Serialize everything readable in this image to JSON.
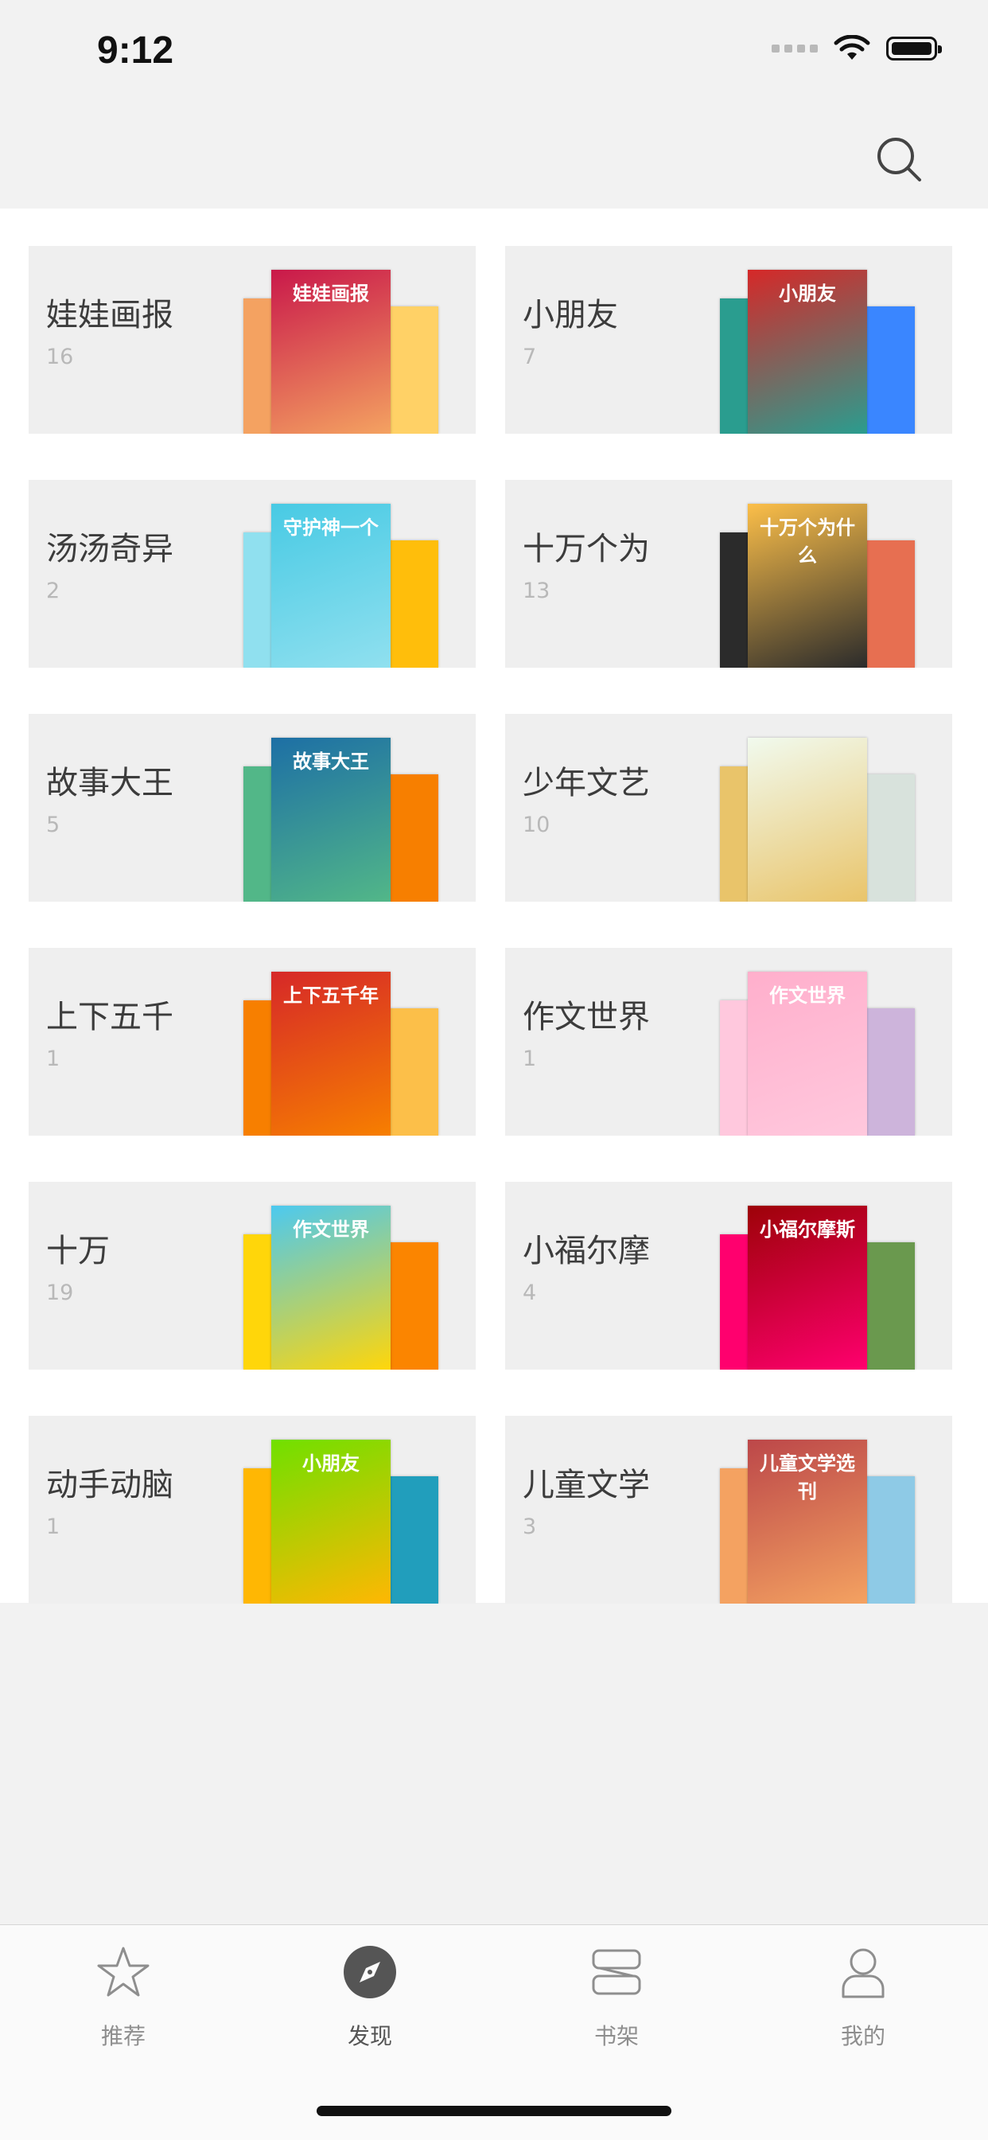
{
  "status": {
    "time": "9:12"
  },
  "categories": [
    {
      "title": "娃娃画报",
      "count": "16",
      "cover": "娃娃画报",
      "colors": [
        "#c9184a",
        "#f4a261",
        "#ffd166"
      ]
    },
    {
      "title": "小朋友",
      "count": "7",
      "cover": "小朋友",
      "colors": [
        "#d62828",
        "#2a9d8f",
        "#3a86ff"
      ]
    },
    {
      "title": "汤汤奇异",
      "count": "2",
      "cover": "守护神一个",
      "colors": [
        "#48cae4",
        "#90e0ef",
        "#ffbe0b"
      ]
    },
    {
      "title": "十万个为",
      "count": "13",
      "cover": "十万个为什么",
      "colors": [
        "#fcbf49",
        "#2b2b2b",
        "#e76f51"
      ]
    },
    {
      "title": "故事大王",
      "count": "5",
      "cover": "故事大王",
      "colors": [
        "#1d6fa5",
        "#52b788",
        "#f77f00"
      ]
    },
    {
      "title": "少年文艺",
      "count": "10",
      "cover": "",
      "colors": [
        "#f1faee",
        "#e9c46a",
        "#d8e2dc"
      ]
    },
    {
      "title": "上下五千",
      "count": "1",
      "cover": "上下五千年",
      "colors": [
        "#d62828",
        "#f77f00",
        "#fcbf49"
      ]
    },
    {
      "title": "作文世界",
      "count": "1",
      "cover": "作文世界",
      "colors": [
        "#ffafcc",
        "#ffc8dd",
        "#cdb4db"
      ]
    },
    {
      "title": "十万",
      "count": "19",
      "cover": "作文世界",
      "colors": [
        "#4cc9f0",
        "#ffd60a",
        "#fb8500"
      ]
    },
    {
      "title": "小福尔摩",
      "count": "4",
      "cover": "小福尔摩斯",
      "colors": [
        "#9d0208",
        "#ff006e",
        "#6a994e"
      ]
    },
    {
      "title": "动手动脑",
      "count": "1",
      "cover": "小朋友",
      "colors": [
        "#70e000",
        "#ffb703",
        "#219ebc"
      ]
    },
    {
      "title": "儿童文学",
      "count": "3",
      "cover": "儿童文学选刊",
      "colors": [
        "#bc4749",
        "#f4a261",
        "#8ecae6"
      ]
    }
  ],
  "tabs": [
    {
      "label": "推荐",
      "icon": "star-icon"
    },
    {
      "label": "发现",
      "icon": "compass-icon"
    },
    {
      "label": "书架",
      "icon": "bookshelf-icon"
    },
    {
      "label": "我的",
      "icon": "person-icon"
    }
  ]
}
